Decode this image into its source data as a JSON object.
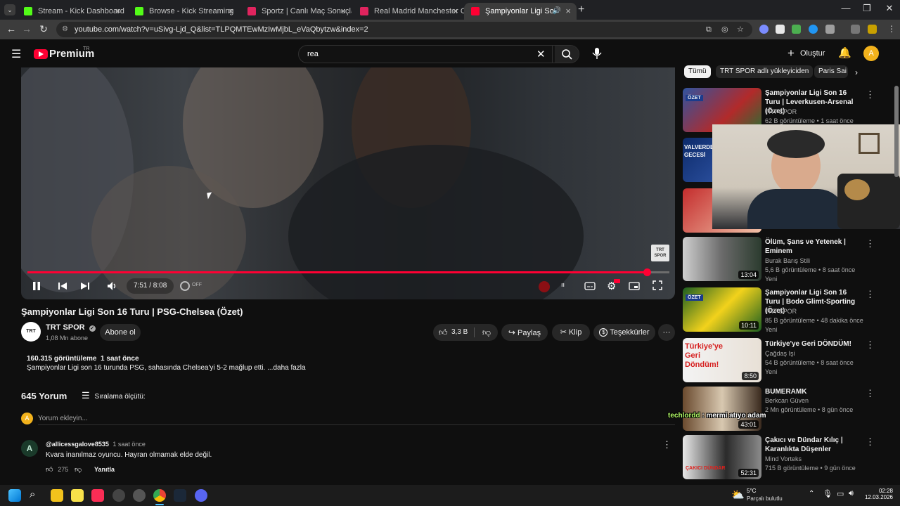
{
  "browser": {
    "tabs": [
      {
        "label": "Stream - Kick Dashboard",
        "color": "#53fc18"
      },
      {
        "label": "Browse - Kick Streaming",
        "color": "#53fc18"
      },
      {
        "label": "Sportz | Canlı Maç Sonuçları ve",
        "color": "#e0245e"
      },
      {
        "label": "Real Madrid Manchester City M",
        "color": "#e0245e"
      },
      {
        "label": "Şampiyonlar Ligi Son 16 Tu",
        "color": "#ff0033"
      }
    ],
    "url": "youtube.com/watch?v=uSivg-Ljd_Q&list=TLPQMTEwMzIwMjbL_eVaQbytzw&index=2"
  },
  "youtube": {
    "logo_text": "Premium",
    "logo_region": "TR",
    "search_value": "rea",
    "create_label": "Oluştur"
  },
  "player": {
    "time": "7:51 / 8:08",
    "progress": 0.965,
    "autoplay_label": "OFF",
    "watermark": "TRT SPOR"
  },
  "video": {
    "title": "Şampiyonlar Ligi Son 16 Turu | PSG-Chelsea (Özet)",
    "channel": "TRT SPOR",
    "subscribers": "1,08 Mn abone",
    "subscribe_label": "Abone ol",
    "likes": "3,3 B",
    "share_label": "Paylaş",
    "clip_label": "Klip",
    "thanks_label": "Teşekkürler",
    "views_line": "160.315 görüntüleme  1 saat önce",
    "description": "Şampiyonlar Ligi son 16 turunda PSG, sahasında Chelsea'yi 5-2 mağlup etti. ...daha fazla"
  },
  "comments": {
    "count": "645 Yorum",
    "sort_label": "Sıralama ölçütü:",
    "add_placeholder": "Yorum ekleyin...",
    "first": {
      "user": "@allicessgalove8535",
      "time": "1 saat önce",
      "text": "Kvara inanılmaz oyuncu. Hayran olmamak elde değil.",
      "likes": "275",
      "reply_label": "Yanıtla"
    }
  },
  "sidebar": {
    "chips": [
      "Tümü",
      "TRT SPOR adlı yükleyiciden",
      "Paris Sai"
    ],
    "recs": [
      {
        "title": "Şampiyonlar Ligi Son 16 Turu | Leverkusen-Arsenal (Özet)",
        "channel": "TRT SPOR",
        "meta": "62 B görüntüleme • 1 saat önce",
        "duration": "",
        "new": "",
        "thumb_text": "ÖZET"
      },
      {
        "title": "",
        "channel": "",
        "meta": "",
        "duration": "",
        "new": "",
        "thumb_text": "VALVERDE'NİN GECESİ"
      },
      {
        "title": "",
        "channel": "",
        "meta": "",
        "duration": "",
        "new": "",
        "thumb_text": ""
      },
      {
        "title": "Ölüm, Şans ve Yetenek | Eminem",
        "channel": "Burak Barış Stili",
        "meta": "5,6 B görüntüleme • 8 saat önce",
        "duration": "13:04",
        "new": "Yeni",
        "thumb_text": ""
      },
      {
        "title": "Şampiyonlar Ligi Son 16 Turu | Bodo Glimt-Sporting (Özet)",
        "channel": "TRT SPOR",
        "meta": "85 B görüntüleme • 48 dakika önce",
        "duration": "10:11",
        "new": "Yeni",
        "thumb_text": "ÖZET"
      },
      {
        "title": "Türkiye'ye Geri DÖNDÜM!",
        "channel": "Çağdaş Işi",
        "meta": "54 B görüntüleme • 8 saat önce",
        "duration": "8:50",
        "new": "Yeni",
        "thumb_text": "Türkiye'ye Geri Döndüm!"
      },
      {
        "title": "BUMERAMK",
        "channel": "Berkcan Güven",
        "meta": "2 Mn görüntüleme • 8 gün önce",
        "duration": "43:01",
        "new": "",
        "thumb_text": ""
      },
      {
        "title": "Çakıcı ve Dündar Kılıç | Karanlıkta Düşenler",
        "channel": "Mind Vorteks",
        "meta": "715 B görüntüleme • 9 gün önce",
        "duration": "52:31",
        "new": "",
        "thumb_text": "ÇAKICI DÜNDAR"
      }
    ]
  },
  "overlay": {
    "chat_user": "techlordd",
    "chat_text": ": mermi atıyo adam"
  },
  "taskbar": {
    "weather_temp": "5°C",
    "weather_text": "Parçalı bulutlu",
    "time": "02:28",
    "date": "12.03.2026"
  }
}
